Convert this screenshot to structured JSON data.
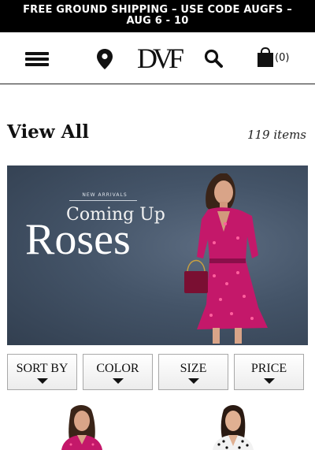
{
  "promo": {
    "line1": "FREE GROUND SHIPPING – USE CODE AUGFS –",
    "line2": "AUG 6 - 10"
  },
  "header": {
    "logo": "DVF",
    "bag_count": "(0)"
  },
  "icons": {
    "menu": "hamburger-menu-icon",
    "location": "map-pin-icon",
    "search": "search-icon",
    "bag": "shopping-bag-icon"
  },
  "page": {
    "title": "View All",
    "item_count": "119 items"
  },
  "banner": {
    "kicker": "NEW ARRIVALS",
    "subtitle": "Coming Up",
    "headline": "Roses"
  },
  "filters": [
    {
      "label": "SORT BY"
    },
    {
      "label": "COLOR"
    },
    {
      "label": "SIZE"
    },
    {
      "label": "PRICE"
    }
  ],
  "colors": {
    "promo_bg": "#000000",
    "banner_bg": "#3f4e61",
    "dress_pink": "#c4186a",
    "text": "#111111"
  }
}
